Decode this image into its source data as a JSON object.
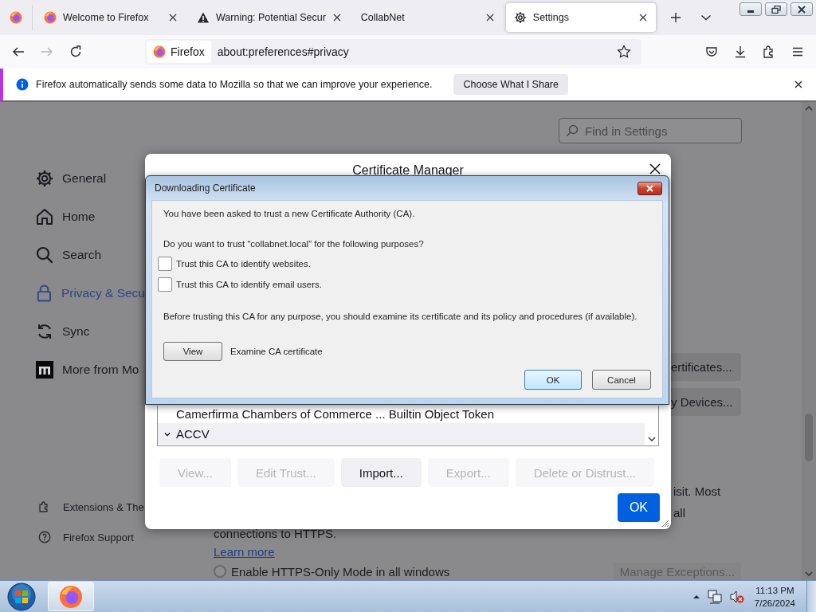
{
  "tabs": [
    {
      "label": "Welcome to Firefox",
      "kind": "firefox",
      "selected": false
    },
    {
      "label": "Warning: Potential Secur",
      "kind": "warning",
      "selected": false
    },
    {
      "label": "CollabNet",
      "kind": "blank",
      "selected": false
    },
    {
      "label": "Settings",
      "kind": "gear",
      "selected": true
    }
  ],
  "toolbar": {
    "identity": "Firefox",
    "url": "about:preferences#privacy"
  },
  "notification": {
    "text": "Firefox automatically sends some data to Mozilla so that we can improve your experience.",
    "button": "Choose What I Share"
  },
  "settings": {
    "search": {
      "placeholder": "Find in Settings"
    },
    "sidebar": {
      "items": [
        {
          "label": "General",
          "kind": "gear",
          "selected": false
        },
        {
          "label": "Home",
          "kind": "home",
          "selected": false
        },
        {
          "label": "Search",
          "kind": "search",
          "selected": false
        },
        {
          "label": "Privacy & Secu",
          "kind": "lock",
          "selected": true
        },
        {
          "label": "Sync",
          "kind": "sync",
          "selected": false
        },
        {
          "label": "More from Mo",
          "kind": "logo",
          "selected": false
        }
      ],
      "footer": [
        {
          "label": "Extensions & The",
          "kind": "puzzle"
        },
        {
          "label": "Firefox Support",
          "kind": "help"
        }
      ]
    },
    "buttons": [
      "ertificates...",
      "y Devices..."
    ],
    "text_fragments": [
      "isit. Most",
      "all"
    ],
    "https_only": {
      "description": "connections to HTTPS.",
      "link": "Learn more",
      "option": {
        "label": "Enable HTTPS-Only Mode in all windows",
        "selected": false
      },
      "button": "Manage Exceptions..."
    }
  },
  "certificate_manager": {
    "title": "Certificate Manager",
    "rows": [
      {
        "kind": "certificate",
        "label": "Camerfirma Chambers of Commerce ... Builtin Object Token"
      },
      {
        "kind": "group",
        "label": "ACCV",
        "expanded": true
      }
    ],
    "buttons": [
      {
        "label": "View...",
        "disabled": true
      },
      {
        "label": "Edit Trust...",
        "disabled": true
      },
      {
        "label": "Import...",
        "disabled": false
      },
      {
        "label": "Export...",
        "disabled": true
      },
      {
        "label": "Delete or Distrust...",
        "disabled": true
      }
    ],
    "ok": "OK"
  },
  "download_dialog": {
    "title": "Downloading Certificate",
    "intro": "You have been asked to trust a new Certificate Authority (CA).",
    "question": "Do you want to trust “collabnet.local” for the following purposes?",
    "options": [
      {
        "label": "Trust this CA to identify websites.",
        "checked": false
      },
      {
        "label": "Trust this CA to identify email users.",
        "checked": false
      }
    ],
    "advice": "Before trusting this CA for any purpose, you should examine its certificate and its policy and procedures (if available).",
    "view_button": "View",
    "view_label": "Examine CA certificate",
    "ok": "OK",
    "cancel": "Cancel"
  },
  "taskbar": {
    "time": "11:13 PM",
    "date": "7/26/2024"
  }
}
